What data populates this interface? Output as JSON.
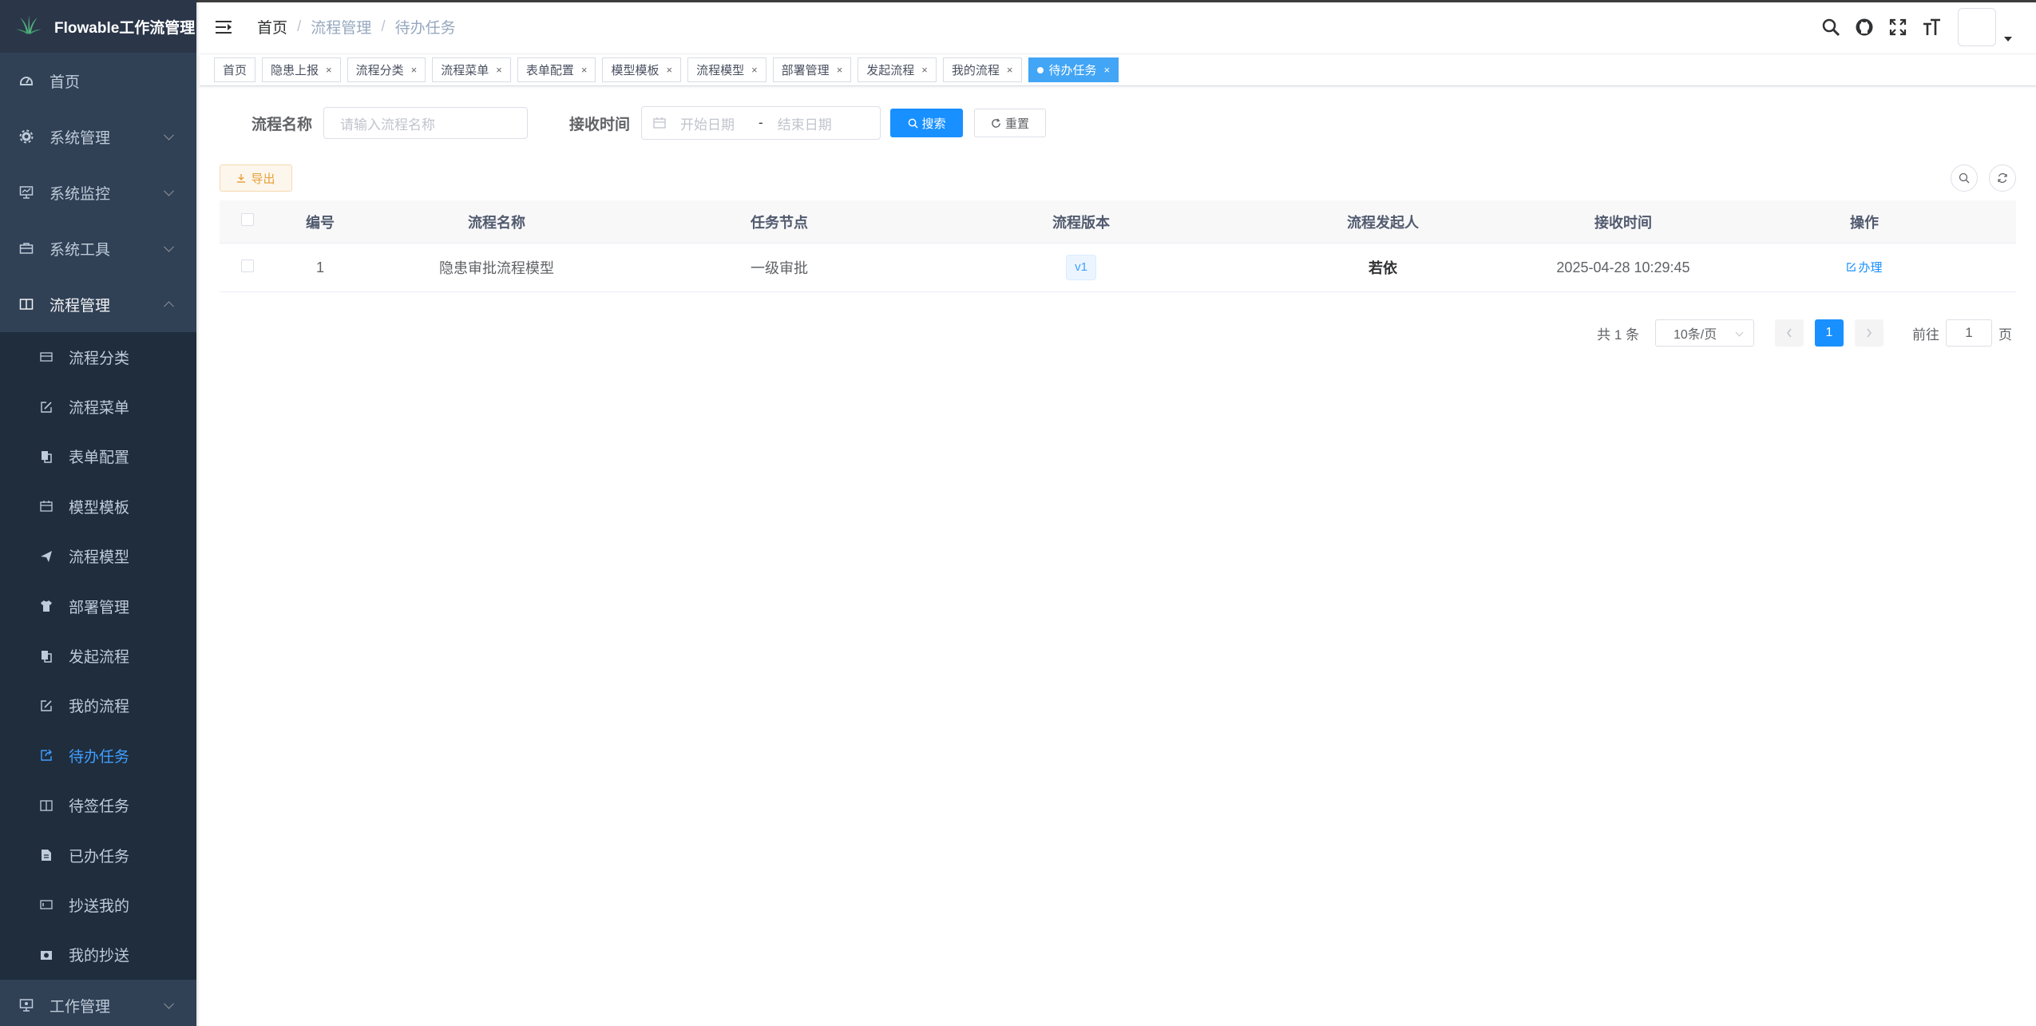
{
  "app": {
    "title": "Flowable工作流管理"
  },
  "sidebar": {
    "items": [
      {
        "label": "首页",
        "icon": "dashboard-icon"
      },
      {
        "label": "系统管理",
        "icon": "gear-icon"
      },
      {
        "label": "系统监控",
        "icon": "monitor-icon"
      },
      {
        "label": "系统工具",
        "icon": "toolbox-icon"
      },
      {
        "label": "流程管理",
        "icon": "book-icon"
      }
    ],
    "submenu": [
      {
        "label": "流程分类",
        "icon": "list-icon"
      },
      {
        "label": "流程菜单",
        "icon": "edit-icon"
      },
      {
        "label": "表单配置",
        "icon": "copy-icon"
      },
      {
        "label": "模型模板",
        "icon": "calendar-icon"
      },
      {
        "label": "流程模型",
        "icon": "send-icon"
      },
      {
        "label": "部署管理",
        "icon": "shirt-icon"
      },
      {
        "label": "发起流程",
        "icon": "copy-icon"
      },
      {
        "label": "我的流程",
        "icon": "edit-icon"
      },
      {
        "label": "待办任务",
        "icon": "share-icon"
      },
      {
        "label": "待签任务",
        "icon": "book-icon"
      },
      {
        "label": "已办任务",
        "icon": "document-icon"
      },
      {
        "label": "抄送我的",
        "icon": "tag-icon"
      },
      {
        "label": "我的抄送",
        "icon": "camera-icon"
      }
    ],
    "bottom_item": {
      "label": "工作管理",
      "icon": "monitor-icon"
    }
  },
  "breadcrumb": [
    "首页",
    "流程管理",
    "待办任务"
  ],
  "tags": [
    "首页",
    "隐患上报",
    "流程分类",
    "流程菜单",
    "表单配置",
    "模型模板",
    "流程模型",
    "部署管理",
    "发起流程",
    "我的流程",
    "待办任务"
  ],
  "search": {
    "name_label": "流程名称",
    "name_placeholder": "请输入流程名称",
    "time_label": "接收时间",
    "start_placeholder": "开始日期",
    "range_separator": "-",
    "end_placeholder": "结束日期",
    "search_button": "搜索",
    "reset_button": "重置"
  },
  "toolbar": {
    "export_button": "导出"
  },
  "table": {
    "columns": [
      "编号",
      "流程名称",
      "任务节点",
      "流程版本",
      "流程发起人",
      "接收时间",
      "操作"
    ],
    "rows": [
      {
        "id": "1",
        "name": "隐患审批流程模型",
        "node": "一级审批",
        "version": "v1",
        "initiator": "若依",
        "time": "2025-04-28 10:29:45",
        "action": "办理"
      }
    ]
  },
  "pagination": {
    "total_text": "共 1 条",
    "page_size": "10条/页",
    "current_page": "1",
    "goto_label": "前往",
    "goto_value": "1",
    "page_unit": "页"
  },
  "colors": {
    "sidebar_bg": "#304156",
    "primary": "#1890ff",
    "active_tag": "#42a5f5",
    "warning": "#e6a23c"
  }
}
